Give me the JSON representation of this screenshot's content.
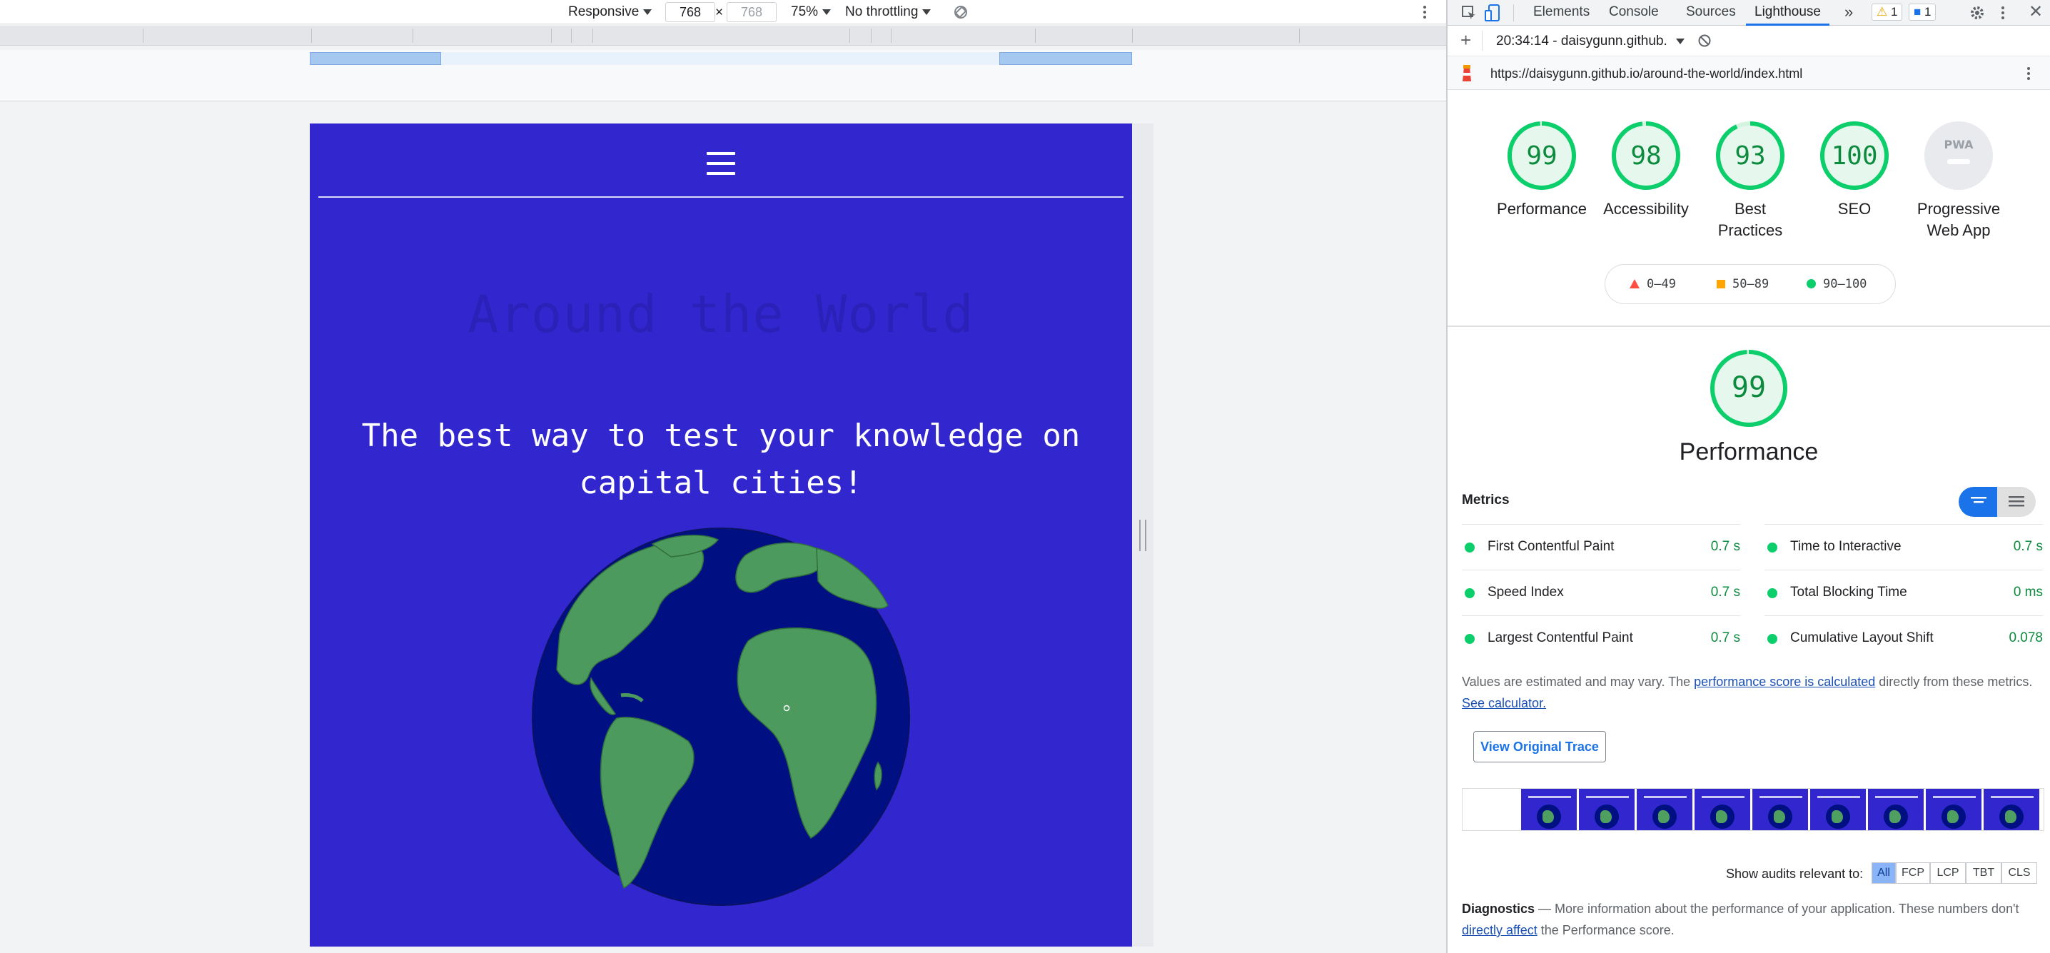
{
  "device_toolbar": {
    "mode": "Responsive",
    "width": "768",
    "height_placeholder": "768",
    "zoom": "75%",
    "throttling": "No throttling",
    "times_symbol": "×"
  },
  "site": {
    "title": "Around the World",
    "tagline": "The best way to test your knowledge on capital cities!",
    "background": "#3227cf",
    "globe_ocean": "#000f82",
    "globe_land": "#4c9a5d"
  },
  "devtools": {
    "tabs": [
      "Elements",
      "Console",
      "Sources",
      "Lighthouse"
    ],
    "active_tab": "Lighthouse",
    "more_tabs_symbol": "»",
    "warnings_count": "1",
    "messages_count": "1",
    "report_selector": "20:34:14 - daisygunn.github.io",
    "url": "https://daisygunn.github.io/around-the-world/index.html"
  },
  "lighthouse": {
    "scores": [
      {
        "label": "Performance",
        "value": "99",
        "fraction": 0.99
      },
      {
        "label": "Accessibility",
        "value": "98",
        "fraction": 0.98
      },
      {
        "label": "Best Practices",
        "value": "93",
        "fraction": 0.93
      },
      {
        "label": "SEO",
        "value": "100",
        "fraction": 1.0
      }
    ],
    "pwa": {
      "label": "Progressive Web App",
      "badge": "PWA"
    },
    "legend": [
      {
        "range": "0–49",
        "color": "#ff4e42"
      },
      {
        "range": "50–89",
        "color": "#ffa400"
      },
      {
        "range": "90–100",
        "color": "#0cce6b"
      }
    ],
    "performance": {
      "score": "99",
      "title": "Performance",
      "metrics_heading": "Metrics",
      "metrics": [
        {
          "name": "First Contentful Paint",
          "value": "0.7 s"
        },
        {
          "name": "Time to Interactive",
          "value": "0.7 s"
        },
        {
          "name": "Speed Index",
          "value": "0.7 s"
        },
        {
          "name": "Total Blocking Time",
          "value": "0 ms"
        },
        {
          "name": "Largest Contentful Paint",
          "value": "0.7 s"
        },
        {
          "name": "Cumulative Layout Shift",
          "value": "0.078"
        }
      ],
      "note_start": "Values are estimated and may vary. The ",
      "note_link": "performance score is calculated",
      "note_mid": " directly from these metrics. ",
      "note_link2": "See calculator.",
      "trace_button": "View Original Trace",
      "audits_label": "Show audits relevant to:",
      "audit_filters": [
        "All",
        "FCP",
        "LCP",
        "TBT",
        "CLS"
      ],
      "diagnostics_heading": "Diagnostics",
      "diagnostics_dash": " — ",
      "diagnostics_text": "More information about the performance of your application. These numbers don't ",
      "diagnostics_link": "directly affect",
      "diagnostics_end": " the Performance score."
    },
    "good_color": "#0cce6b"
  }
}
